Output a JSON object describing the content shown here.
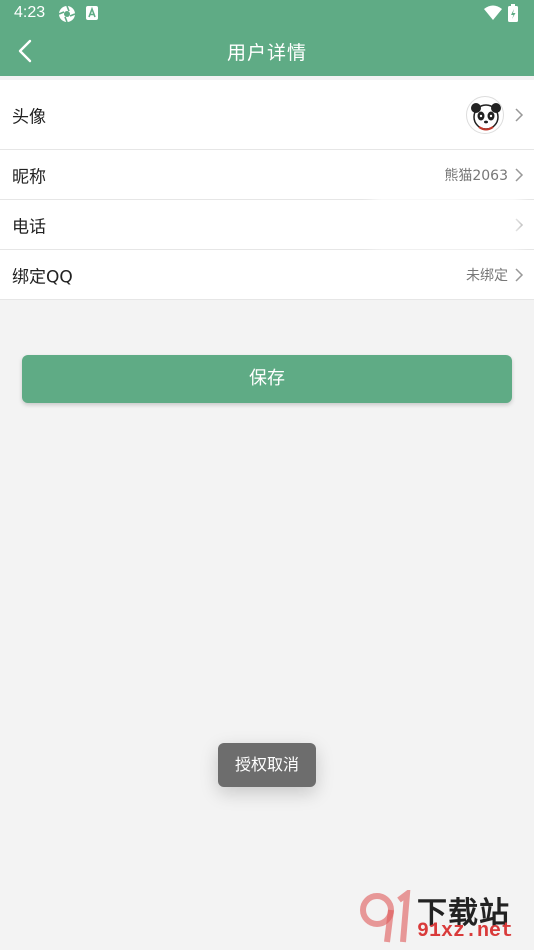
{
  "status": {
    "time": "4:23"
  },
  "appbar": {
    "title": "用户详情"
  },
  "rows": {
    "avatar": {
      "label": "头像"
    },
    "nickname": {
      "label": "昵称",
      "value": "熊猫2063"
    },
    "phone": {
      "label": "电话",
      "value": ""
    },
    "qq": {
      "label": "绑定QQ",
      "value": "未绑定"
    }
  },
  "save_button": {
    "label": "保存"
  },
  "toast": {
    "text": "授权取消"
  },
  "watermark": {
    "line1": "下载站",
    "line2": "91xz.net"
  },
  "colors": {
    "accent": "#5fab85",
    "background": "#f3f3f3",
    "toast": "#6d6d6d"
  }
}
